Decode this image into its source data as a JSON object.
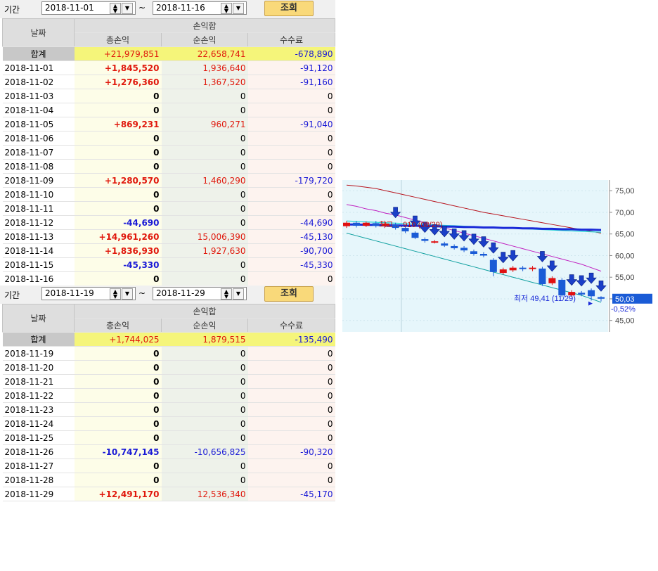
{
  "filter1": {
    "label": "기간",
    "from": "2018-11-01",
    "to": "2018-11-16",
    "tilde": "~",
    "button": "조회"
  },
  "filter2": {
    "label": "기간",
    "from": "2018-11-19",
    "to": "2018-11-29",
    "tilde": "~",
    "button": "조회"
  },
  "headers": {
    "date": "날짜",
    "group": "손익합",
    "total": "총손익",
    "net": "순손익",
    "fee": "수수료"
  },
  "table1": {
    "sum": {
      "label": "합계",
      "total": "+21,979,851",
      "net": "22,658,741",
      "fee": "-678,890"
    },
    "rows": [
      {
        "date": "2018-11-01",
        "total": "+1,845,520",
        "net": "1,936,640",
        "fee": "-91,120"
      },
      {
        "date": "2018-11-02",
        "total": "+1,276,360",
        "net": "1,367,520",
        "fee": "-91,160"
      },
      {
        "date": "2018-11-03",
        "total": "0",
        "net": "0",
        "fee": "0"
      },
      {
        "date": "2018-11-04",
        "total": "0",
        "net": "0",
        "fee": "0"
      },
      {
        "date": "2018-11-05",
        "total": "+869,231",
        "net": "960,271",
        "fee": "-91,040"
      },
      {
        "date": "2018-11-06",
        "total": "0",
        "net": "0",
        "fee": "0"
      },
      {
        "date": "2018-11-07",
        "total": "0",
        "net": "0",
        "fee": "0"
      },
      {
        "date": "2018-11-08",
        "total": "0",
        "net": "0",
        "fee": "0"
      },
      {
        "date": "2018-11-09",
        "total": "+1,280,570",
        "net": "1,460,290",
        "fee": "-179,720"
      },
      {
        "date": "2018-11-10",
        "total": "0",
        "net": "0",
        "fee": "0"
      },
      {
        "date": "2018-11-11",
        "total": "0",
        "net": "0",
        "fee": "0"
      },
      {
        "date": "2018-11-12",
        "total": "-44,690",
        "net": "0",
        "fee": "-44,690"
      },
      {
        "date": "2018-11-13",
        "total": "+14,961,260",
        "net": "15,006,390",
        "fee": "-45,130"
      },
      {
        "date": "2018-11-14",
        "total": "+1,836,930",
        "net": "1,927,630",
        "fee": "-90,700"
      },
      {
        "date": "2018-11-15",
        "total": "-45,330",
        "net": "0",
        "fee": "-45,330"
      },
      {
        "date": "2018-11-16",
        "total": "0",
        "net": "0",
        "fee": "0"
      }
    ]
  },
  "table2": {
    "sum": {
      "label": "합계",
      "total": "+1,744,025",
      "net": "1,879,515",
      "fee": "-135,490"
    },
    "rows": [
      {
        "date": "2018-11-19",
        "total": "0",
        "net": "0",
        "fee": "0"
      },
      {
        "date": "2018-11-20",
        "total": "0",
        "net": "0",
        "fee": "0"
      },
      {
        "date": "2018-11-21",
        "total": "0",
        "net": "0",
        "fee": "0"
      },
      {
        "date": "2018-11-22",
        "total": "0",
        "net": "0",
        "fee": "0"
      },
      {
        "date": "2018-11-23",
        "total": "0",
        "net": "0",
        "fee": "0"
      },
      {
        "date": "2018-11-24",
        "total": "0",
        "net": "0",
        "fee": "0"
      },
      {
        "date": "2018-11-25",
        "total": "0",
        "net": "0",
        "fee": "0"
      },
      {
        "date": "2018-11-26",
        "total": "-10,747,145",
        "net": "-10,656,825",
        "fee": "-90,320"
      },
      {
        "date": "2018-11-27",
        "total": "0",
        "net": "0",
        "fee": "0"
      },
      {
        "date": "2018-11-28",
        "total": "0",
        "net": "0",
        "fee": "0"
      },
      {
        "date": "2018-11-29",
        "total": "+12,491,170",
        "net": "12,536,340",
        "fee": "-45,170"
      }
    ]
  },
  "colors": {
    "positive": "#e0180c",
    "negative": "#1a1ad6",
    "header_bg": "#dedede",
    "sum_bg": "#f5f57a",
    "button": "#f9d97a",
    "chart_bg": "#e6f6fb"
  },
  "chart_data": {
    "type": "candlestick",
    "y_ticks": [
      "75,00",
      "70,00",
      "65,00",
      "60,00",
      "55,00",
      "50,00",
      "45,00"
    ],
    "ylim": [
      43,
      76.5
    ],
    "current_price": "50,03",
    "change": "-0,52%",
    "low_label": "최저 49,41 (11/29)",
    "high_label_partial": "최고 …910 (08/29)",
    "candles": [
      {
        "o": 66.8,
        "c": 67.6,
        "h": 68.0,
        "l": 66.4
      },
      {
        "o": 67.6,
        "c": 66.9,
        "h": 68.0,
        "l": 66.5
      },
      {
        "o": 66.9,
        "c": 67.6,
        "h": 67.9,
        "l": 66.6
      },
      {
        "o": 67.5,
        "c": 66.9,
        "h": 68.0,
        "l": 66.5
      },
      {
        "o": 66.9,
        "c": 67.4,
        "h": 67.8,
        "l": 66.6
      },
      {
        "o": 67.2,
        "c": 66.4,
        "h": 67.6,
        "l": 66.0
      },
      {
        "o": 66.4,
        "c": 65.6,
        "h": 66.8,
        "l": 65.2
      },
      {
        "o": 65.3,
        "c": 64.1,
        "h": 65.6,
        "l": 63.8
      },
      {
        "o": 63.8,
        "c": 63.4,
        "h": 64.2,
        "l": 63.0
      },
      {
        "o": 63.0,
        "c": 63.3,
        "h": 63.6,
        "l": 62.8
      },
      {
        "o": 62.8,
        "c": 62.3,
        "h": 63.2,
        "l": 62.0
      },
      {
        "o": 62.2,
        "c": 61.7,
        "h": 62.6,
        "l": 61.4
      },
      {
        "o": 61.8,
        "c": 61.2,
        "h": 62.2,
        "l": 60.8
      },
      {
        "o": 61.0,
        "c": 60.4,
        "h": 61.4,
        "l": 60.0
      },
      {
        "o": 60.4,
        "c": 60.0,
        "h": 60.8,
        "l": 59.6
      },
      {
        "o": 59.0,
        "c": 56.2,
        "h": 59.4,
        "l": 55.2
      },
      {
        "o": 56.0,
        "c": 56.8,
        "h": 57.2,
        "l": 55.6
      },
      {
        "o": 56.6,
        "c": 57.2,
        "h": 57.6,
        "l": 56.2
      },
      {
        "o": 57.2,
        "c": 57.0,
        "h": 57.6,
        "l": 56.4
      },
      {
        "o": 56.9,
        "c": 57.2,
        "h": 57.6,
        "l": 56.4
      },
      {
        "o": 57.0,
        "c": 53.4,
        "h": 57.4,
        "l": 53.0
      },
      {
        "o": 53.6,
        "c": 54.8,
        "h": 55.2,
        "l": 53.2
      },
      {
        "o": 54.4,
        "c": 50.8,
        "h": 54.8,
        "l": 50.4
      },
      {
        "o": 50.8,
        "c": 51.6,
        "h": 52.0,
        "l": 50.4
      },
      {
        "o": 51.4,
        "c": 51.0,
        "h": 51.8,
        "l": 50.6
      },
      {
        "o": 52.0,
        "c": 50.6,
        "h": 52.4,
        "l": 49.6
      },
      {
        "o": 50.4,
        "c": 50.03,
        "h": 50.6,
        "l": 49.41
      }
    ],
    "arrows_at": [
      6,
      8,
      9,
      10,
      11,
      12,
      13,
      14,
      15,
      16,
      17,
      18,
      19,
      20,
      23,
      24,
      26,
      27,
      28,
      29,
      30
    ],
    "upper_band": [
      71.8,
      71.4,
      70.8,
      70.4,
      69.8,
      69.4,
      68.8,
      68.2,
      67.6,
      67.0,
      66.4,
      65.8,
      65.2,
      64.6,
      64.0,
      63.4,
      62.8,
      62.2,
      61.6,
      61.0,
      60.4,
      59.8,
      59.2,
      58.6,
      58.0,
      57.2,
      56.4
    ],
    "lower_band": [
      65.2,
      64.6,
      64.0,
      63.4,
      62.8,
      62.2,
      61.6,
      61.0,
      60.4,
      59.8,
      59.2,
      58.6,
      58.0,
      57.4,
      56.8,
      56.2,
      55.6,
      55.0,
      54.4,
      53.8,
      53.2,
      52.6,
      52.0,
      51.4,
      50.8,
      50.0,
      49.2
    ],
    "ma_blue": [
      67.2,
      67.2,
      67.1,
      67.1,
      67.0,
      67.0,
      66.9,
      66.9,
      66.8,
      66.8,
      66.7,
      66.7,
      66.6,
      66.6,
      66.5,
      66.5,
      66.4,
      66.4,
      66.3,
      66.3,
      66.2,
      66.2,
      66.1,
      66.1,
      66.0,
      66.0,
      65.9
    ],
    "ma_cyan": [
      68.0,
      67.9,
      67.8,
      67.7,
      67.6,
      67.5,
      67.4,
      67.3,
      67.2,
      67.1,
      67.0,
      66.9,
      66.8,
      66.7,
      66.6,
      66.5,
      66.4,
      66.3,
      66.2,
      66.1,
      66.0,
      65.9,
      65.8,
      65.7,
      65.6,
      65.5,
      65.4
    ],
    "ma_darkred": [
      76.3,
      76.1,
      75.8,
      75.5,
      75.0,
      74.5,
      74.0,
      73.5,
      73.0,
      72.5,
      72.0,
      71.5,
      71.0,
      70.5,
      70.0,
      69.6,
      69.2,
      68.8,
      68.4,
      68.0,
      67.6,
      67.2,
      66.8,
      66.4,
      66.0,
      65.6,
      65.2
    ]
  }
}
